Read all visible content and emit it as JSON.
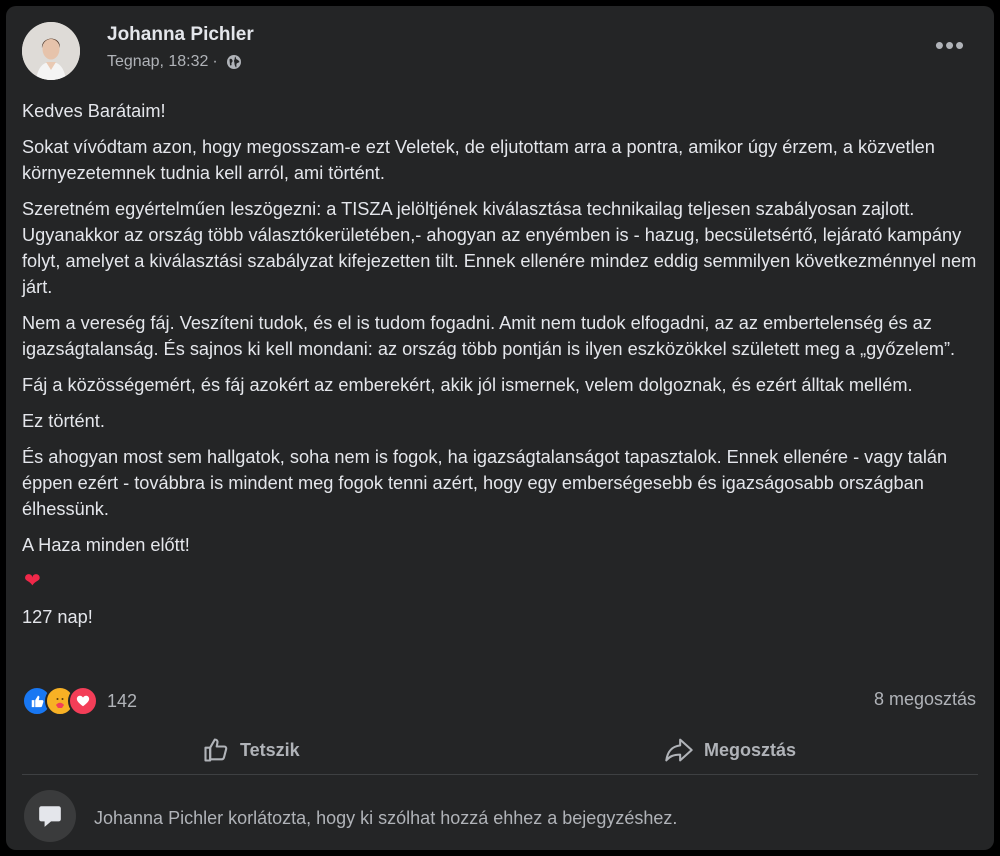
{
  "post": {
    "author": "Johanna Pichler",
    "timestamp": "Tegnap, 18:32",
    "separator": "·",
    "paragraphs": [
      "Kedves Barátaim!",
      "Sokat vívódtam azon, hogy megosszam-e ezt Veletek, de eljutottam arra a pontra, amikor úgy érzem, a közvetlen környezetemnek tudnia kell arról, ami történt.",
      "Szeretném egyértelműen leszögezni: a TISZA  jelöltjének kiválasztása technikailag teljesen szabályosan zajlott.",
      "Ugyanakkor az ország több választókerületében,- ahogyan az enyémben is - hazug, becsületsértő, lejárató kampány folyt, amelyet a kiválasztási szabályzat kifejezetten tilt. Ennek ellenére mindez eddig semmilyen következménnyel nem járt.",
      "Nem a vereség fáj. Veszíteni tudok, és el is tudom fogadni. Amit nem tudok elfogadni, az az embertelenség és az igazságtalanság. És sajnos ki kell mondani: az ország több pontján is ilyen eszközökkel született meg a „győzelem”.",
      "Fáj a közösségemért, és fáj azokért az emberekért, akik jól ismernek, velem dolgoznak, és ezért álltak mellém.",
      "Ez történt.",
      "És ahogyan most sem hallgatok, soha nem is fogok, ha igazságtalanságot tapasztalok. Ennek ellenére - vagy talán éppen ezért - továbbra is mindent meg fogok tenni azért, hogy egy emberségesebb és igazságosabb országban élhessünk.",
      "A Haza minden előtt!",
      "127 nap!"
    ],
    "flag_colors": [
      "#cd2a3e",
      "#ffffff",
      "#436f4d"
    ],
    "heart_glyph": "❤"
  },
  "reactions": {
    "icons": [
      "like-icon",
      "care-icon",
      "love-icon"
    ],
    "count": "142",
    "shares": "8 megosztás"
  },
  "actions": {
    "like_label": "Tetszik",
    "share_label": "Megosztás"
  },
  "comments": {
    "restricted_text": "Johanna Pichler korlátozta, hogy ki szólhat hozzá ehhez a bejegyzéshez."
  },
  "colors": {
    "card_bg": "#242526",
    "text_primary": "#e4e6eb",
    "text_secondary": "#b0b3b8",
    "like_blue": "#1877f2",
    "love_red": "#f33e58",
    "care_yellow": "#f7b125"
  }
}
